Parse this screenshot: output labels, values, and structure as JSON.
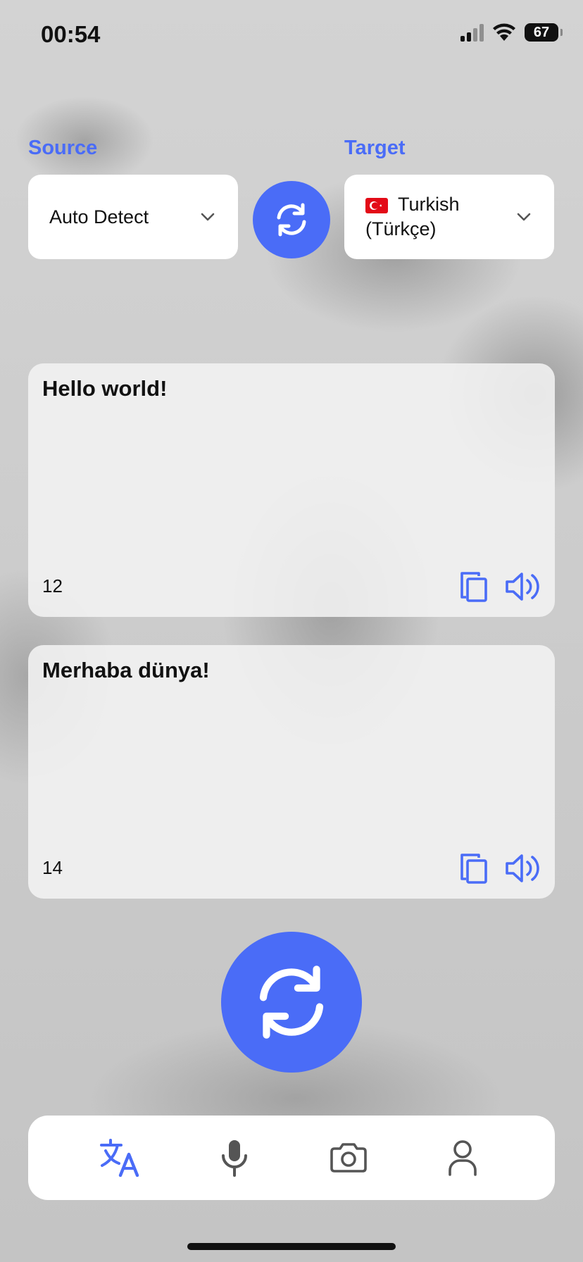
{
  "status_bar": {
    "time": "00:54",
    "battery": "67"
  },
  "languages": {
    "source_label": "Source",
    "target_label": "Target",
    "source_value": "Auto Detect",
    "target_value_line1": "Turkish",
    "target_value_line2": "(Türkçe)",
    "target_flag": "turkey-flag"
  },
  "input_card": {
    "text": "Hello world!",
    "char_count": "12"
  },
  "output_card": {
    "text": "Merhaba dünya!",
    "char_count": "14"
  },
  "tabs": [
    {
      "icon": "translate-icon",
      "active": true
    },
    {
      "icon": "microphone-icon",
      "active": false
    },
    {
      "icon": "camera-icon",
      "active": false
    },
    {
      "icon": "profile-icon",
      "active": false
    }
  ],
  "colors": {
    "accent": "#4a6cf7",
    "inactive_icon": "#555555"
  }
}
